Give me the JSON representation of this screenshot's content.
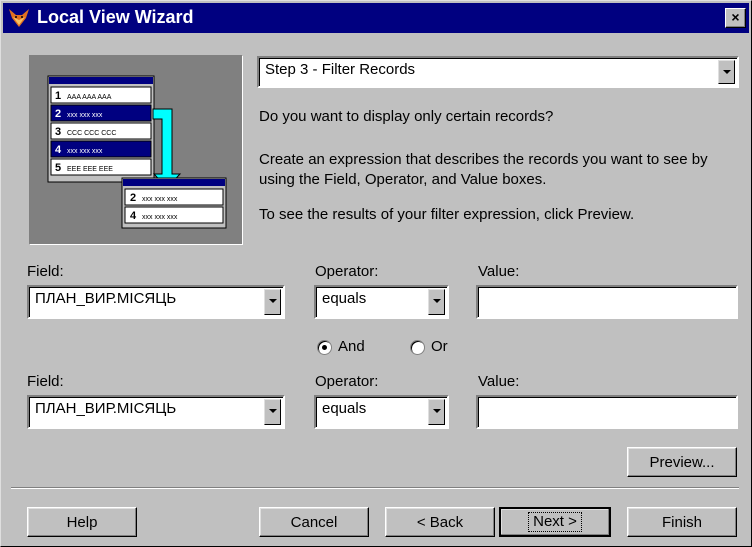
{
  "window": {
    "title": "Local View Wizard",
    "close_glyph": "×"
  },
  "step_select": {
    "value": "Step 3 - Filter Records"
  },
  "info": {
    "question": "Do you want to display only certain records?",
    "description": "Create an expression that describes the records you want to see by using the Field, Operator, and Value boxes.",
    "hint": "To see the results of your filter expression, click Preview."
  },
  "picture": {
    "rows_top": [
      {
        "num": "1",
        "text": "AAA AAA AAA"
      },
      {
        "num": "2",
        "text": "xxx xxx xxx"
      },
      {
        "num": "3",
        "text": "CCC CCC CCC"
      },
      {
        "num": "4",
        "text": "xxx xxx xxx"
      },
      {
        "num": "5",
        "text": "EEE EEE EEE"
      }
    ],
    "rows_bottom": [
      {
        "num": "2",
        "text": "xxx xxx xxx"
      },
      {
        "num": "4",
        "text": "xxx xxx xxx"
      }
    ]
  },
  "filter1": {
    "field_label": "Field:",
    "field_value": "ПЛАН_ВИР.МІСЯЦЬ",
    "operator_label": "Operator:",
    "operator_value": "equals",
    "value_label": "Value:",
    "value": ""
  },
  "connector": {
    "and_label": "And",
    "or_label": "Or",
    "selected": "And"
  },
  "filter2": {
    "field_label": "Field:",
    "field_value": "ПЛАН_ВИР.МІСЯЦЬ",
    "operator_label": "Operator:",
    "operator_value": "equals",
    "value_label": "Value:",
    "value": ""
  },
  "buttons": {
    "preview": "Preview...",
    "help": "Help",
    "cancel": "Cancel",
    "back": "< Back",
    "next": "Next >",
    "finish": "Finish"
  },
  "colors": {
    "titlebar": "#000080",
    "face": "#c0c0c0",
    "table_header": "#000080",
    "arrow": "#00ffff"
  }
}
